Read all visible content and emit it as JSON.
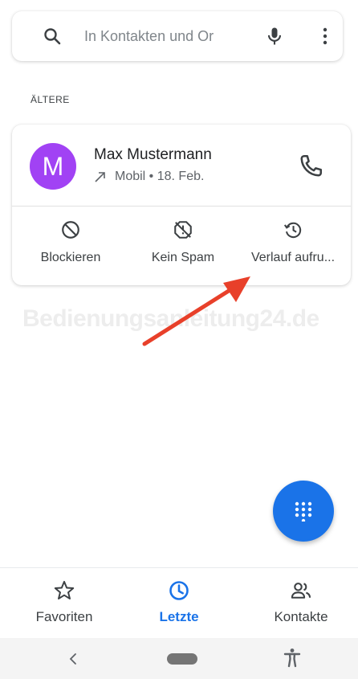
{
  "search": {
    "placeholder": "In Kontakten und Or"
  },
  "section": {
    "label": "ÄLTERE"
  },
  "call_entry": {
    "avatar_letter": "M",
    "avatar_color": "#a142f4",
    "name": "Max Mustermann",
    "meta": "Mobil • 18. Feb.",
    "actions": [
      {
        "label": "Blockieren",
        "icon": "block-icon"
      },
      {
        "label": "Kein Spam",
        "icon": "not-spam-icon"
      },
      {
        "label": "Verlauf aufru...",
        "icon": "history-icon"
      }
    ]
  },
  "watermark": "Bedienungsanleitung24.de",
  "bottom_nav": {
    "items": [
      {
        "label": "Favoriten",
        "icon": "star-icon",
        "active": false
      },
      {
        "label": "Letzte",
        "icon": "clock-icon",
        "active": true
      },
      {
        "label": "Kontakte",
        "icon": "people-icon",
        "active": false
      }
    ]
  },
  "colors": {
    "accent": "#1a73e8",
    "annotation_arrow": "#e8402a"
  }
}
